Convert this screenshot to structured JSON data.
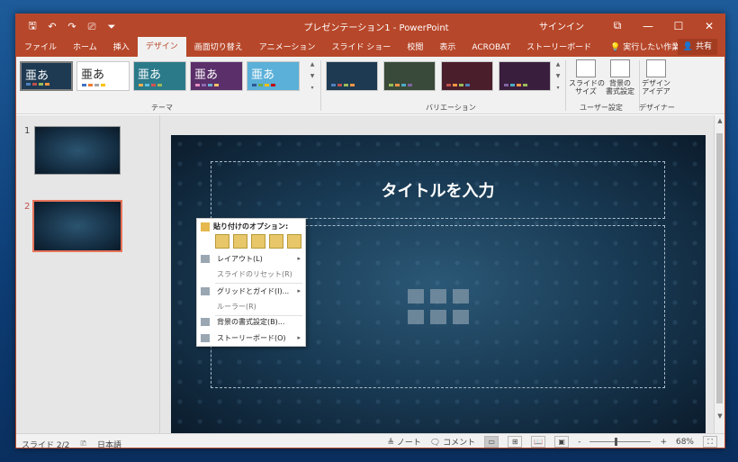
{
  "titlebar": {
    "doc_title": "プレゼンテーション1 - PowerPoint",
    "signin": "サインイン",
    "qat_icons": [
      "save-icon",
      "undo-icon",
      "redo-icon",
      "present-icon",
      "customize-icon"
    ],
    "qat_glyphs": [
      "🖫",
      "↶",
      "↷",
      "⎚",
      "⏷"
    ],
    "ribbon_display_glyph": "⧉",
    "minimize_glyph": "—",
    "maximize_glyph": "☐",
    "close_glyph": "✕"
  },
  "tabs": [
    {
      "label": "ファイル"
    },
    {
      "label": "ホーム"
    },
    {
      "label": "挿入"
    },
    {
      "label": "デザイン"
    },
    {
      "label": "画面切り替え"
    },
    {
      "label": "アニメーション"
    },
    {
      "label": "スライド ショー"
    },
    {
      "label": "校閲"
    },
    {
      "label": "表示"
    },
    {
      "label": "ACROBAT"
    },
    {
      "label": "ストーリーボード"
    }
  ],
  "active_tab": "デザイン",
  "tell_me": "実行したい作業を入力してください",
  "tell_me_icon": "lightbulb-icon",
  "share": "共有",
  "ribbon": {
    "themes": [
      {
        "char": "亜あ",
        "bg": "#1d3a52"
      },
      {
        "char": "亜あ",
        "bg": "#ffffff"
      },
      {
        "char": "亜あ",
        "bg": "#2b7a8a"
      },
      {
        "char": "亜あ",
        "bg": "#5a2f6a"
      },
      {
        "char": "亜あ",
        "bg": "#5ab0d8"
      }
    ],
    "themes_label": "テーマ",
    "variations": [
      {
        "bg": "#1d3a52"
      },
      {
        "bg": "#3a4a3a"
      },
      {
        "bg": "#4a1e2a"
      },
      {
        "bg": "#3a1e3e"
      }
    ],
    "variations_label": "バリエーション",
    "slide_size": "スライドの\nサイズ",
    "format_background": "背景の\n書式設定",
    "customize_label": "ユーザー設定",
    "design_ideas": "デザイン\nアイデア",
    "designer_label": "デザイナー",
    "scroll_up_glyph": "▲",
    "scroll_down_glyph": "▼",
    "more_glyph": "▾"
  },
  "slides": [
    {
      "num": "1"
    },
    {
      "num": "2"
    }
  ],
  "slide": {
    "title_placeholder": "タイトルを入力"
  },
  "context_menu": {
    "paste_header": "貼り付けのオプション:",
    "items": [
      {
        "label": "レイアウト(L)",
        "submenu": true,
        "dim": false
      },
      {
        "label": "スライドのリセット(R)",
        "submenu": false,
        "dim": true
      },
      {
        "label": "グリッドとガイド(I)...",
        "submenu": true,
        "dim": false
      },
      {
        "label": "ルーラー(R)",
        "submenu": false,
        "dim": true
      },
      {
        "label": "背景の書式設定(B)...",
        "submenu": false,
        "dim": false
      },
      {
        "label": "ストーリーボード(O)",
        "submenu": true,
        "dim": false
      }
    ],
    "submenu_glyph": "▸"
  },
  "statusbar": {
    "slide_count": "スライド 2/2",
    "language": "日本語",
    "notes": "ノート",
    "comments": "コメント",
    "zoom": "68%",
    "zoom_minus": "-",
    "zoom_plus": "+"
  }
}
